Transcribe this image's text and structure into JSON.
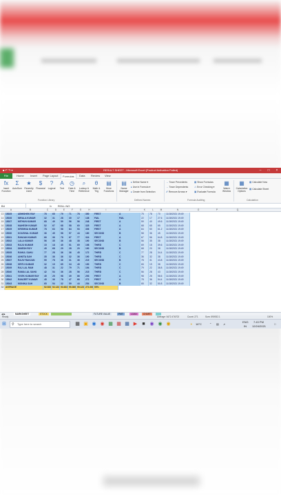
{
  "window": {
    "title": "RESULT SHEET - Microsoft Excel (Product Activation Failed)",
    "quick_access": "■ ↶ ↷ ▾"
  },
  "tabs": [
    "File",
    "Home",
    "Insert",
    "Page Layout",
    "Formulas",
    "Data",
    "Review",
    "View"
  ],
  "active_tab": "Formulas",
  "ribbon": {
    "library": [
      {
        "label": "Insert Function",
        "icon": "fx"
      },
      {
        "label": "AutoSum",
        "icon": "Σ"
      },
      {
        "label": "Recently Used",
        "icon": "★"
      },
      {
        "label": "Financial",
        "icon": "$"
      },
      {
        "label": "Logical",
        "icon": "?"
      },
      {
        "label": "Text",
        "icon": "A"
      },
      {
        "label": "Date & Time",
        "icon": "◷"
      },
      {
        "label": "Lookup & Reference",
        "icon": "⌕"
      },
      {
        "label": "Math & Trig",
        "icon": "θ"
      },
      {
        "label": "More Functions",
        "icon": "▤"
      }
    ],
    "library_group": "Function Library",
    "name_manager": "Name Manager",
    "names_items": [
      "Define Name ▾",
      "Use in Formula ▾",
      "Create from Selection"
    ],
    "names_group": "Defined Names",
    "audit_items": [
      "Trace Precedents",
      "Trace Dependents",
      "Remove Arrows ▾",
      "Show Formulas",
      "Error Checking ▾",
      "Evaluate Formula"
    ],
    "watch": "Watch Window",
    "audit_group": "Formula Auditing",
    "calc_options": "Calculation Options",
    "calc_items": [
      "Calculate Now",
      "Calculate Sheet"
    ],
    "calc_group": "Calculation"
  },
  "formula_bar": {
    "name_box": "B4",
    "fx": "fx",
    "content": "ROLL NO"
  },
  "columns": [
    "A",
    "B",
    "C",
    "D",
    "E",
    "F",
    "G",
    "H",
    "I",
    "J",
    "K",
    "L",
    "M",
    "N",
    "O",
    "P",
    "Q"
  ],
  "rows": [
    {
      "n": "13",
      "roll": "15025",
      "name": "ABHISHEK RAY",
      "m": [
        "78",
        "65",
        "79",
        "71",
        "78"
      ],
      "tot": "350",
      "res": "FIRST",
      "grd": "A",
      "x": [
        "75",
        "78",
        "70"
      ],
      "date": "11/18/2021 19:49"
    },
    {
      "n": "14",
      "roll": "15026",
      "name": "NIRALA KUMAR",
      "m": [
        "32",
        "31",
        "28",
        "30",
        "17"
      ],
      "tot": "138",
      "res": "FAIL",
      "grd": "FAIL",
      "x": [
        "22",
        "17",
        "27.6"
      ],
      "date": "11/18/2021 19:49"
    },
    {
      "n": "15",
      "roll": "15027",
      "name": "MITHUN KUMAR",
      "m": [
        "68",
        "49",
        "59",
        "56",
        "56"
      ],
      "tot": "248",
      "res": "FIRST",
      "grd": "A",
      "x": [
        "59",
        "40",
        "49.6"
      ],
      "date": "11/18/2021 19:49"
    },
    {
      "n": "16",
      "roll": "15028",
      "name": "MAHESH KUMAR",
      "m": [
        "52",
        "67",
        "68",
        "58",
        "60"
      ],
      "tot": "325",
      "res": "FIRST",
      "grd": "A",
      "x": [
        "68",
        "65",
        "65"
      ],
      "date": "11/18/2021 19:49"
    },
    {
      "n": "17",
      "roll": "15029",
      "name": "KRISHNA KUMAR",
      "m": [
        "78",
        "63",
        "58",
        "84",
        "53"
      ],
      "tot": "306",
      "res": "FIRST",
      "grd": "A",
      "x": [
        "84",
        "50",
        "61.2"
      ],
      "date": "11/18/2021 19:49"
    },
    {
      "n": "18",
      "roll": "15030",
      "name": "KOUSHAL KUMAR",
      "m": [
        "36",
        "45",
        "58",
        "57",
        "44"
      ],
      "tot": "180",
      "res": "SECOND",
      "grd": "B",
      "x": [
        "58",
        "36",
        "45"
      ],
      "date": "11/18/2021 19:49"
    },
    {
      "n": "19",
      "roll": "15031",
      "name": "RANJAN KUMAR",
      "m": [
        "66",
        "36",
        "78",
        "67",
        "77"
      ],
      "tot": "324",
      "res": "FIRST",
      "grd": "A",
      "x": [
        "67",
        "56",
        "64.8"
      ],
      "date": "11/18/2021 19:49"
    },
    {
      "n": "20",
      "roll": "15032",
      "name": "LALA KUMAR",
      "m": [
        "56",
        "35",
        "36",
        "48",
        "38"
      ],
      "tot": "190",
      "res": "SECOND",
      "grd": "B",
      "x": [
        "56",
        "35",
        "38"
      ],
      "date": "11/18/2021 19:49"
    },
    {
      "n": "21",
      "roll": "15033",
      "name": "RAJU KUMAR",
      "m": [
        "15",
        "18",
        "45",
        "51",
        "69"
      ],
      "tot": "198",
      "res": "THIRD",
      "grd": "C",
      "x": [
        "69",
        "15",
        "39.6"
      ],
      "date": "11/18/2021 19:49"
    },
    {
      "n": "22",
      "roll": "15034",
      "name": "DINESH ROY",
      "m": [
        "45",
        "68",
        "29",
        "28",
        "20"
      ],
      "tot": "190",
      "res": "SECOND",
      "grd": "B",
      "x": [
        "68",
        "20",
        "38"
      ],
      "date": "11/18/2021 19:49"
    },
    {
      "n": "23",
      "roll": "15035",
      "name": "RAHUL SAHU",
      "m": [
        "77",
        "28",
        "36",
        "36",
        "45"
      ],
      "tot": "172",
      "res": "THIRD",
      "grd": "C",
      "x": [
        "77",
        "28",
        "34.4"
      ],
      "date": "11/18/2021 19:49"
    },
    {
      "n": "24",
      "roll": "15036",
      "name": "ANKITA SAH",
      "m": [
        "35",
        "36",
        "36",
        "32",
        "36"
      ],
      "tot": "190",
      "res": "THIRD",
      "grd": "C",
      "x": [
        "36",
        "32",
        "38"
      ],
      "date": "11/18/2021 19:49"
    },
    {
      "n": "25",
      "roll": "15037",
      "name": "RAJIV RANJAN",
      "m": [
        "59",
        "78",
        "36",
        "31",
        "36"
      ],
      "tot": "219",
      "res": "SECOND",
      "grd": "B",
      "x": [
        "78",
        "31",
        "43.8"
      ],
      "date": "11/18/2021 19:49"
    },
    {
      "n": "26",
      "roll": "15038",
      "name": "SRITU KUMAR",
      "m": [
        "32",
        "19",
        "65",
        "34",
        "49"
      ],
      "tot": "190",
      "res": "THIRD",
      "grd": "C",
      "x": [
        "65",
        "19",
        "38"
      ],
      "date": "11/18/2021 19:49"
    },
    {
      "n": "27",
      "roll": "15039",
      "name": "RAJ LAL RAM",
      "m": [
        "48",
        "31",
        "22",
        "79",
        "71"
      ],
      "tot": "194",
      "res": "THIRD",
      "grd": "C",
      "x": [
        "79",
        "22",
        "38.8"
      ],
      "date": "11/18/2021 19:49"
    },
    {
      "n": "28",
      "roll": "15040",
      "name": "RAMA LAL SAHU",
      "m": [
        "42",
        "54",
        "36",
        "28",
        "56"
      ],
      "tot": "215",
      "res": "THIRD",
      "grd": "C",
      "x": [
        "56",
        "28",
        "43"
      ],
      "date": "11/18/2021 19:49"
    },
    {
      "n": "29",
      "roll": "15041",
      "name": "VIVEK KUMAR RAY",
      "m": [
        "45",
        "25",
        "98",
        "39",
        "86"
      ],
      "tot": "293",
      "res": "FIRST",
      "grd": "A",
      "x": [
        "98",
        "25",
        "58.6"
      ],
      "date": "11/18/2021 19:49"
    },
    {
      "n": "30",
      "roll": "15042",
      "name": "RANJEET KUMAR",
      "m": [
        "45",
        "36",
        "78",
        "47",
        "66"
      ],
      "tot": "272",
      "res": "FIRST",
      "grd": "A",
      "x": [
        "78",
        "36",
        "54.4"
      ],
      "date": "11/18/2021 19:49"
    },
    {
      "n": "31",
      "roll": "15043",
      "name": "MONIKA SAH",
      "m": [
        "65",
        "54",
        "32",
        "59",
        "44"
      ],
      "tot": "254",
      "res": "SECOND",
      "grd": "B",
      "x": [
        "65",
        "32",
        "50.8"
      ],
      "date": "11/18/2021 19:49"
    }
  ],
  "avg_row": {
    "n": "32",
    "label": "AVERAGE",
    "m": [
      "52.53333",
      "52.13333",
      "53.63333",
      "55.36667",
      "55.12333"
    ],
    "tot": "271.0667",
    "res": "50%"
  },
  "sheets": [
    "MARKSHEET",
    "STOCK",
    "FUTURE VALUE",
    "PMT",
    "LOAN",
    "CHART"
  ],
  "status": {
    "ready": "Ready",
    "average": "Average: 5472.476702",
    "count": "Count: 271",
    "sum": "Sum: 590932.1",
    "zoom": "100%"
  },
  "taskbar": {
    "search_placeholder": "Type here to search",
    "weather": "16°C",
    "lang": "ENG",
    "region": "IN",
    "time": "7:43 PM",
    "date": "12/24/2021"
  }
}
